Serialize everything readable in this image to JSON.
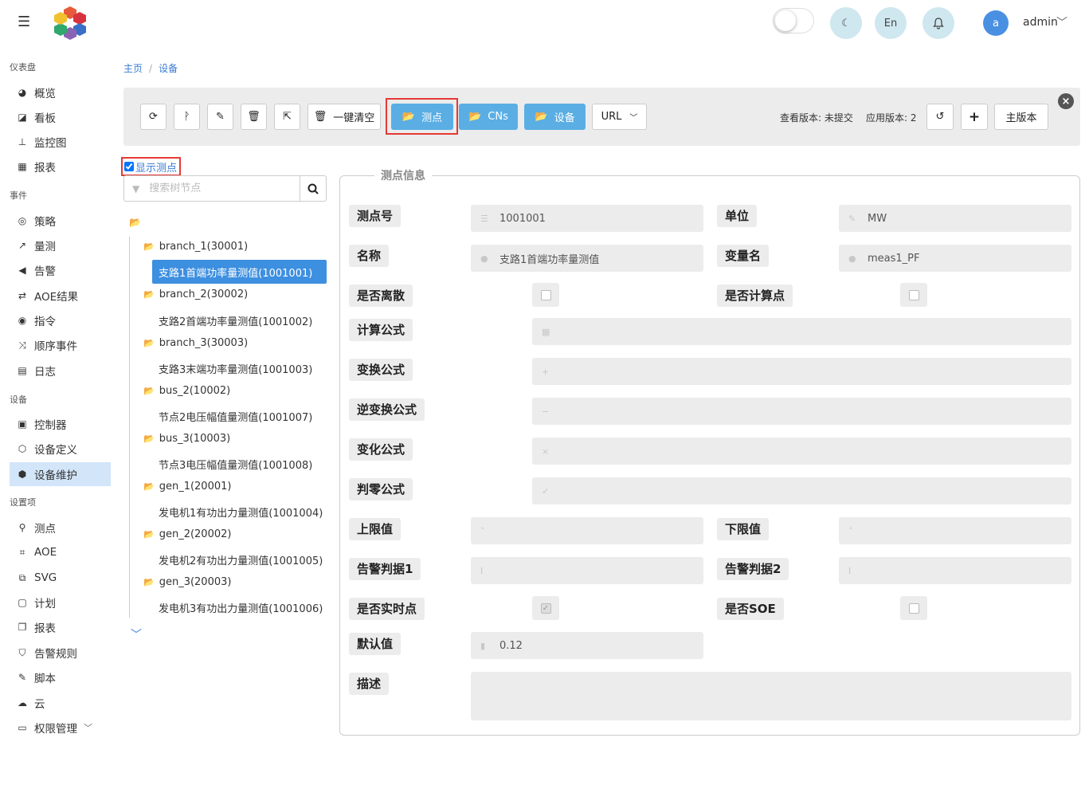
{
  "header": {
    "menu_icon": "hamburger-icon",
    "lang_label": "En",
    "user_avatar": "a",
    "user_name": "admin",
    "theme_icon": "moon-icon",
    "bell_icon": "bell-icon"
  },
  "sidebar": {
    "sections": [
      {
        "title": "仪表盘",
        "items": [
          {
            "label": "概览",
            "icon": "palette-icon"
          },
          {
            "label": "看板",
            "icon": "clone-icon"
          },
          {
            "label": "监控图",
            "icon": "sitemap-icon"
          },
          {
            "label": "报表",
            "icon": "table-icon"
          }
        ]
      },
      {
        "title": "事件",
        "items": [
          {
            "label": "策略",
            "icon": "circle-icon"
          },
          {
            "label": "量测",
            "icon": "chart-line-icon"
          },
          {
            "label": "告警",
            "icon": "bullhorn-icon"
          },
          {
            "label": "AOE结果",
            "icon": "exchange-icon"
          },
          {
            "label": "指令",
            "icon": "radar-icon"
          },
          {
            "label": "顺序事件",
            "icon": "random-icon"
          },
          {
            "label": "日志",
            "icon": "book-icon"
          }
        ]
      },
      {
        "title": "设备",
        "items": [
          {
            "label": "控制器",
            "icon": "microchip-icon"
          },
          {
            "label": "设备定义",
            "icon": "cube-icon"
          },
          {
            "label": "设备维护",
            "icon": "cubes-icon"
          }
        ]
      },
      {
        "title": "设置项",
        "items": [
          {
            "label": "测点",
            "icon": "map-pin-icon"
          },
          {
            "label": "AOE",
            "icon": "project-diagram-icon"
          },
          {
            "label": "SVG",
            "icon": "object-group-icon"
          },
          {
            "label": "计划",
            "icon": "calendar-check-icon"
          },
          {
            "label": "报表",
            "icon": "copy-icon"
          },
          {
            "label": "告警规则",
            "icon": "shield-icon"
          },
          {
            "label": "脚本",
            "icon": "magic-icon"
          },
          {
            "label": "云",
            "icon": "cloud-icon"
          },
          {
            "label": "权限管理",
            "icon": "id-card-icon"
          }
        ]
      }
    ],
    "active": "设备维护"
  },
  "breadcrumb": {
    "home": "主页",
    "current": "设备"
  },
  "toolbar": {
    "clear_all": "一键清空",
    "points": "测点",
    "cns": "CNs",
    "devices": "设备",
    "url": "URL",
    "view_version": "查看版本: 未提交",
    "apply_version": "应用版本: 2",
    "main_version": "主版本"
  },
  "tree": {
    "show_points": "显示测点",
    "show_points_checked": true,
    "search_placeholder": "搜索树节点",
    "nodes": [
      {
        "label": "branch_1(30001)",
        "children": [
          "支路1首端功率量测值(1001001)"
        ]
      },
      {
        "label": "branch_2(30002)",
        "children": [
          "支路2首端功率量测值(1001002)"
        ]
      },
      {
        "label": "branch_3(30003)",
        "children": [
          "支路3末端功率量测值(1001003)"
        ]
      },
      {
        "label": "bus_2(10002)",
        "children": [
          "节点2电压幅值量测值(1001007)"
        ]
      },
      {
        "label": "bus_3(10003)",
        "children": [
          "节点3电压幅值量测值(1001008)"
        ]
      },
      {
        "label": "gen_1(20001)",
        "children": [
          "发电机1有功出力量测值(1001004)"
        ]
      },
      {
        "label": "gen_2(20002)",
        "children": [
          "发电机2有功出力量测值(1001005)"
        ]
      },
      {
        "label": "gen_3(20003)",
        "children": [
          "发电机3有功出力量测值(1001006)"
        ]
      }
    ],
    "selected": "支路1首端功率量测值(1001001)"
  },
  "form": {
    "legend": "测点信息",
    "point_no_label": "测点号",
    "point_no": "1001001",
    "unit_label": "单位",
    "unit": "MW",
    "name_label": "名称",
    "name": "支路1首端功率量测值",
    "var_label": "变量名",
    "var": "meas1_PF",
    "discrete_label": "是否离散",
    "discrete": false,
    "computed_label": "是否计算点",
    "computed": false,
    "calc_formula_label": "计算公式",
    "trans_formula_label": "变换公式",
    "inv_formula_label": "逆变换公式",
    "change_formula_label": "变化公式",
    "zero_formula_label": "判零公式",
    "upper_label": "上限值",
    "lower_label": "下限值",
    "alarm1_label": "告警判据1",
    "alarm2_label": "告警判据2",
    "realtime_label": "是否实时点",
    "realtime": true,
    "soe_label": "是否SOE",
    "soe": false,
    "default_label": "默认值",
    "default": "0.12",
    "desc_label": "描述"
  }
}
